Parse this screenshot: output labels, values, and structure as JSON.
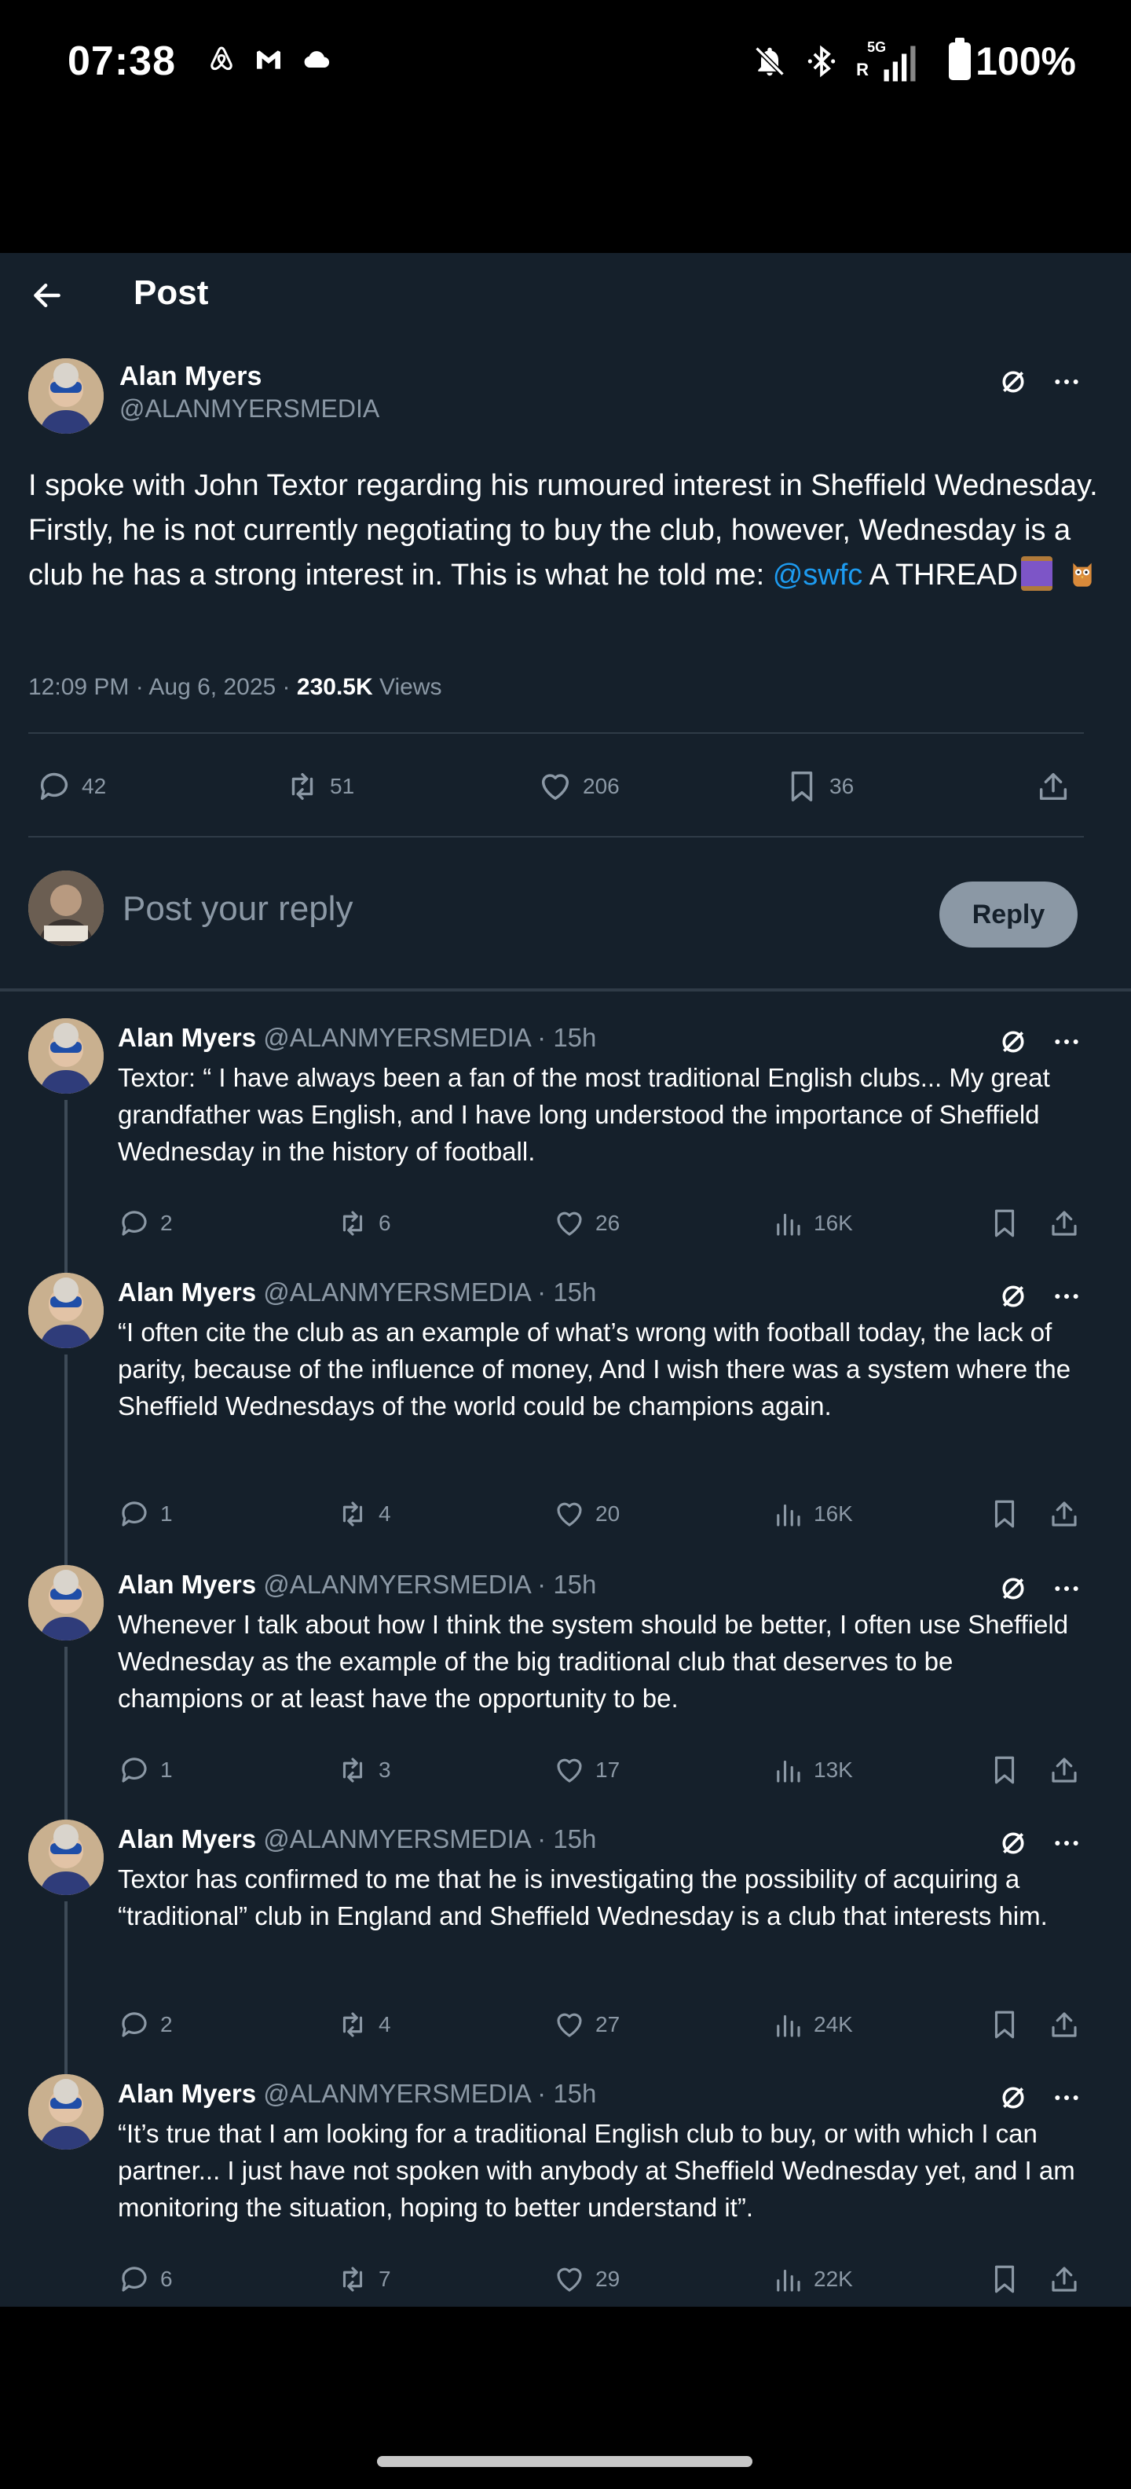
{
  "status_bar": {
    "time": "07:38",
    "app_icons": [
      "airbnb-icon",
      "gmail-icon",
      "cloud-icon"
    ],
    "network": "5G",
    "roaming": "R",
    "battery": "100%"
  },
  "header": {
    "title": "Post"
  },
  "post": {
    "author": "Alan Myers",
    "handle": "@ALANMYERSMEDIA",
    "text_before": "I spoke with John Textor regarding his rumoured interest in Sheffield Wednesday. Firstly, he is not currently negotiating to buy the club, however, Wednesday is a club he has a strong interest in. This is what he told me: ",
    "mention": "@swfc",
    "text_after": " A THREAD",
    "timestamp": "12:09 PM · Aug 6, 2025 · ",
    "views_count": "230.5K",
    "views_label": " Views",
    "replies": "42",
    "reposts": "51",
    "likes": "206",
    "bookmarks": "36"
  },
  "reply_box": {
    "placeholder": "Post your reply",
    "button": "Reply"
  },
  "thread": [
    {
      "name": "Alan Myers",
      "meta": " @ALANMYERSMEDIA · 15h",
      "text": "Textor: “ I have always been a fan of the most traditional English clubs... My great grandfather was English, and I have long understood the importance of Sheffield Wednesday in the history of football.",
      "replies": "2",
      "reposts": "6",
      "likes": "26",
      "views": "16K"
    },
    {
      "name": "Alan Myers",
      "meta": " @ALANMYERSMEDIA · 15h",
      "text": "“I often cite the club as an example of what’s wrong with football today, the lack of parity, because of the influence of money, And I wish there was a system where the Sheffield Wednesdays of the world could be champions again.",
      "replies": "1",
      "reposts": "4",
      "likes": "20",
      "views": "16K"
    },
    {
      "name": "Alan Myers",
      "meta": " @ALANMYERSMEDIA · 15h",
      "text": "Whenever I talk about how I think the system should be better, I often use Sheffield Wednesday as the example of the big traditional club that deserves to be champions or at least have the opportunity to be.",
      "replies": "1",
      "reposts": "3",
      "likes": "17",
      "views": "13K"
    },
    {
      "name": "Alan Myers",
      "meta": " @ALANMYERSMEDIA · 15h",
      "text": "Textor has confirmed to me that he is investigating the possibility of acquiring a “traditional” club in England and Sheffield Wednesday is a club that interests him.",
      "replies": "2",
      "reposts": "4",
      "likes": "27",
      "views": "24K"
    },
    {
      "name": "Alan Myers",
      "meta": " @ALANMYERSMEDIA · 15h",
      "text": "“It’s true that I am looking for a traditional English club to buy, or with which I can partner... I just have not spoken with anybody at Sheffield Wednesday yet, and I am monitoring the situation, hoping to better understand it”.",
      "replies": "6",
      "reposts": "7",
      "likes": "29",
      "views": "22K"
    }
  ],
  "colors": {
    "background": "#15202b",
    "accent": "#1d9bf0",
    "muted": "#8b98a5",
    "divider": "#2f3b47"
  }
}
